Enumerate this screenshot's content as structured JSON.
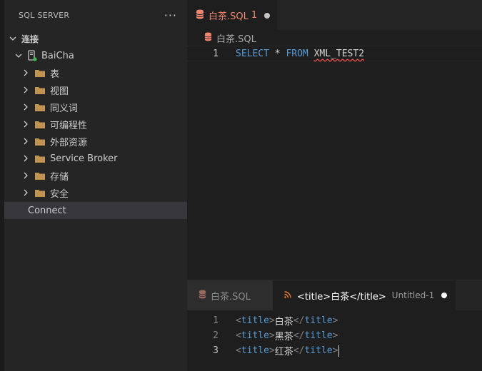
{
  "sidebar": {
    "title": "SQL SERVER",
    "more_label": "···",
    "section_label": "连接",
    "server": {
      "name": "BaiCha",
      "status_color": "#3fb950"
    },
    "folders": [
      {
        "label": "表"
      },
      {
        "label": "视图"
      },
      {
        "label": "同义词"
      },
      {
        "label": "可编程性"
      },
      {
        "label": "外部资源"
      },
      {
        "label": "Service Broker"
      },
      {
        "label": "存储"
      },
      {
        "label": "安全"
      }
    ],
    "connect_label": "Connect"
  },
  "editor": {
    "tab": {
      "label": "白茶.SQL",
      "problems": "1"
    },
    "breadcrumb": "白茶.SQL",
    "lines": [
      {
        "num": "1",
        "kw1": "SELECT",
        "star": "*",
        "kw2": "FROM",
        "table": "XML_TEST2"
      }
    ]
  },
  "results_panel": {
    "tabs": [
      {
        "label": "白茶.SQL"
      },
      {
        "label": "<title>白茶</title>",
        "description": "Untitled-1"
      }
    ],
    "lines": [
      {
        "num": "1",
        "open_tag": "<",
        "tag_name": "title",
        "close_bracket": ">",
        "text": "白茶",
        "end_open": "</",
        "end_name": "title",
        "end_close": ">"
      },
      {
        "num": "2",
        "open_tag": "<",
        "tag_name": "title",
        "close_bracket": ">",
        "text": "黑茶",
        "end_open": "</",
        "end_name": "title",
        "end_close": ">"
      },
      {
        "num": "3",
        "open_tag": "<",
        "tag_name": "title",
        "close_bracket": ">",
        "text": "红茶",
        "end_open": "</",
        "end_name": "title",
        "end_close": ">"
      }
    ]
  },
  "colors": {
    "accent_error": "#f48771",
    "keyword": "#569cd6",
    "folder": "#c09553",
    "rss": "#e37933",
    "db_icon": "#f48771"
  }
}
